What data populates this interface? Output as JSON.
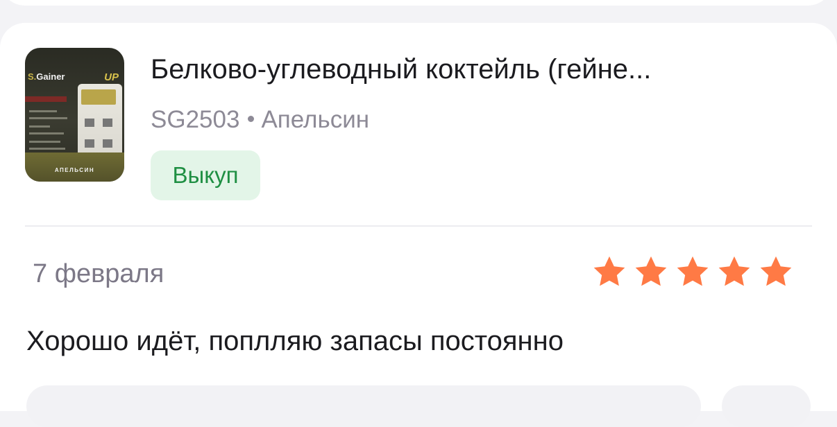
{
  "product": {
    "title": "Белково-углеводный коктейль (гейне...",
    "sku": "SG2503",
    "flavor": "Апельсин",
    "status_badge": "Выкуп",
    "image_brand_s": "S.",
    "image_brand_name": "Gainer",
    "image_up": "UP",
    "image_flavor": "АПЕЛЬСИН"
  },
  "review": {
    "date": "7 февраля",
    "rating": 5,
    "max_rating": 5,
    "text": "Хорошо идёт, поплляю запасы постоянно",
    "star_color": "#ff7a45"
  },
  "colors": {
    "badge_bg": "#e3f5e8",
    "badge_text": "#1f8f43",
    "secondary_text": "#8d8a96"
  }
}
